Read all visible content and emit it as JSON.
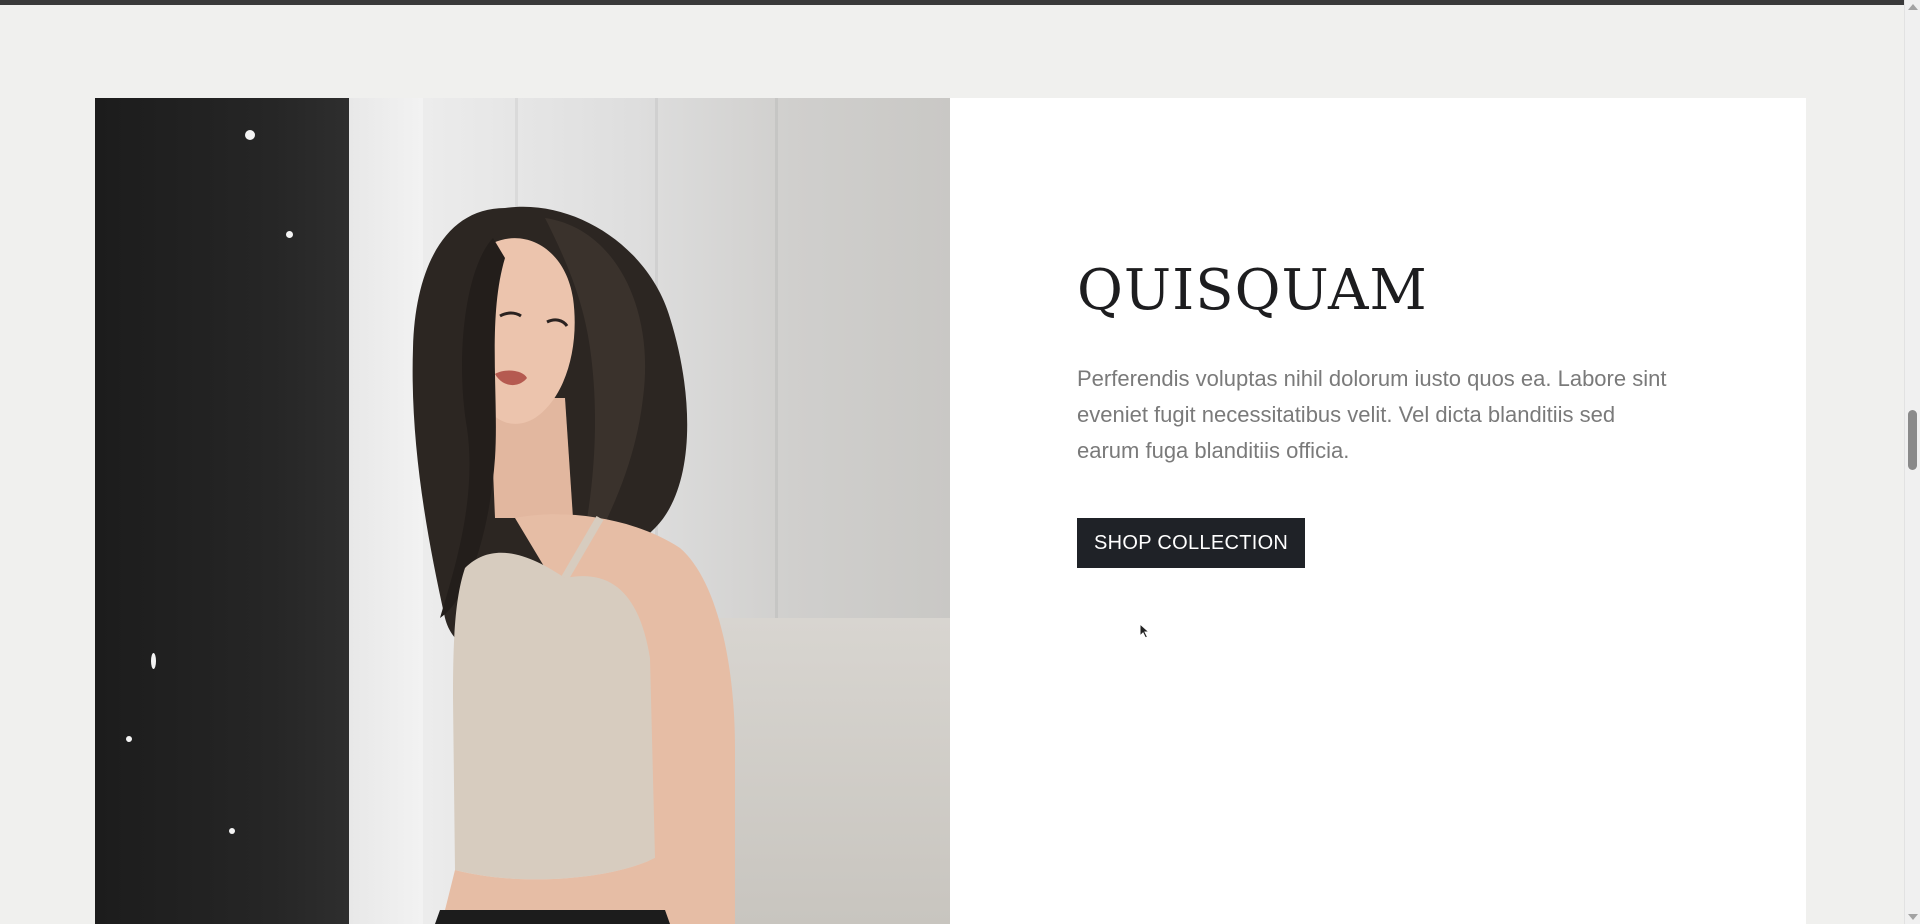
{
  "collection": {
    "title": "QUISQUAM",
    "description": "Perferendis voluptas nihil dolorum iusto quos ea. Labore sint eveniet fugit necessitatibus velit. Vel dicta blanditiis sed earum fuga blanditiis officia.",
    "cta_label": "SHOP COLLECTION",
    "image_icon": "model-photo"
  },
  "colors": {
    "page_background": "#f0f0ee",
    "card_background": "#ffffff",
    "title": "#1d1d1f",
    "body_text": "#7a7a7a",
    "button_background": "#1f2227",
    "button_text": "#ffffff"
  }
}
